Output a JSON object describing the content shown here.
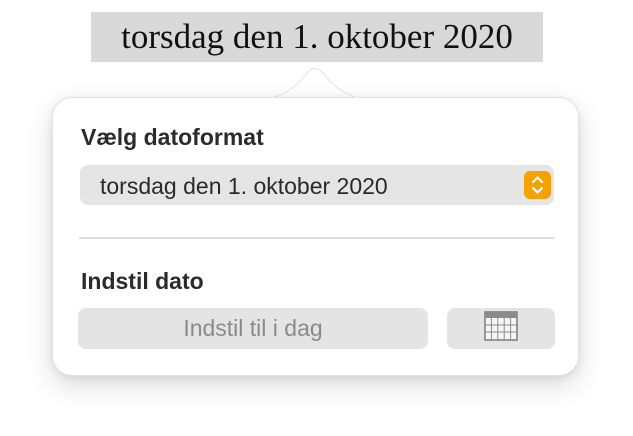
{
  "document": {
    "date_text": "torsdag den 1. oktober 2020"
  },
  "popover": {
    "format_section": {
      "title": "Vælg datoformat",
      "selected_format": "torsdag den 1. oktober 2020"
    },
    "date_section": {
      "title": "Indstil dato",
      "today_button_label": "Indstil til i dag",
      "calendar_icon": "calendar-icon"
    }
  },
  "colors": {
    "accent": "#f5a100",
    "popover_background": "#ffffff",
    "control_background": "#e5e5e5",
    "text_highlight": "#d9d9d9"
  }
}
